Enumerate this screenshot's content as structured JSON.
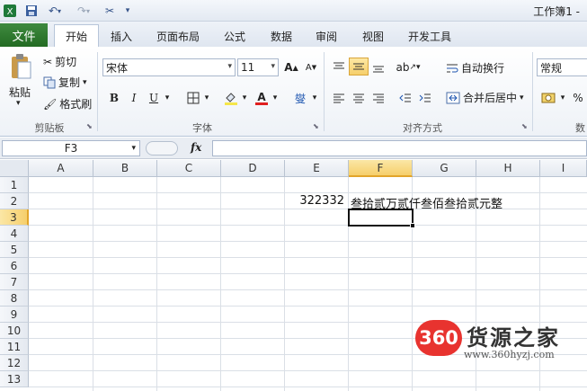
{
  "window": {
    "title": "工作簿1 -"
  },
  "quick_access": {
    "icons": [
      "excel-logo-icon",
      "save-icon",
      "undo-icon",
      "redo-icon",
      "customize-icon"
    ]
  },
  "tabs": [
    {
      "label": "文件"
    },
    {
      "label": "开始"
    },
    {
      "label": "插入"
    },
    {
      "label": "页面布局"
    },
    {
      "label": "公式"
    },
    {
      "label": "数据"
    },
    {
      "label": "审阅"
    },
    {
      "label": "视图"
    },
    {
      "label": "开发工具"
    }
  ],
  "ribbon": {
    "clipboard": {
      "paste": "粘贴",
      "cut": "剪切",
      "copy": "复制",
      "format_painter": "格式刷",
      "label": "剪贴板"
    },
    "font": {
      "name": "宋体",
      "size": "11",
      "bold": "B",
      "italic": "I",
      "underline": "U",
      "wen": "燮",
      "label": "字体"
    },
    "alignment": {
      "wrap_text": "自动换行",
      "merge_center": "合并后居中",
      "label": "对齐方式"
    },
    "number": {
      "format": "常规",
      "percent": "%",
      "label": "数"
    }
  },
  "formula_bar": {
    "name_box": "F3",
    "fx": "fx",
    "value": ""
  },
  "grid": {
    "columns": [
      "A",
      "B",
      "C",
      "D",
      "E",
      "F",
      "G",
      "H",
      "I"
    ],
    "rows": [
      "1",
      "2",
      "3",
      "4",
      "5",
      "6",
      "7",
      "8",
      "9",
      "10",
      "11",
      "12",
      "13"
    ],
    "cells": {
      "E2": "322332",
      "F2": "叁拾贰万贰仟叁佰叁拾贰元整"
    },
    "selected_cell": "F3"
  },
  "watermark": {
    "badge": "360",
    "name": "货源之家",
    "url": "www.360hyzj.com"
  },
  "colors": {
    "file_tab": "#2d7a2d",
    "selection_header": "#f6cf6b",
    "brand": "#e8332f"
  }
}
